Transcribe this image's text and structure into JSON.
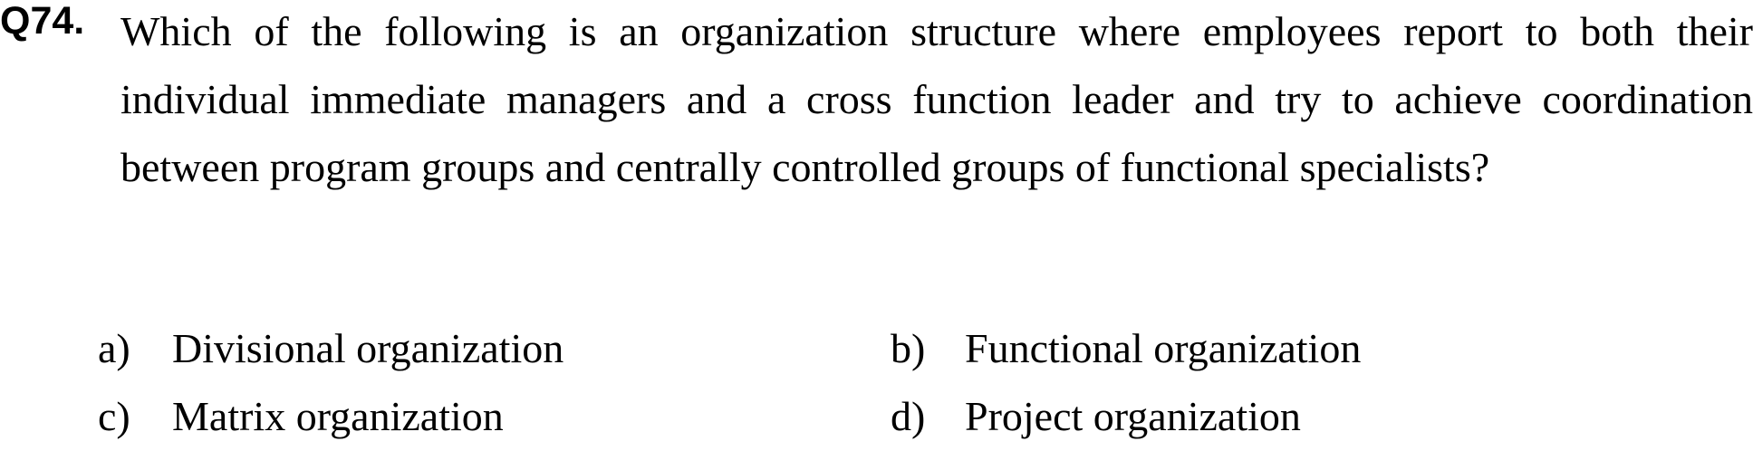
{
  "question": {
    "number": "Q74.",
    "text": "Which of the following is an organization structure where employees report to both their individual immediate managers and a cross function leader and try to achieve coordination between program groups and centrally controlled groups of functional specialists?"
  },
  "options": [
    {
      "letter": "a)",
      "text": "Divisional organization"
    },
    {
      "letter": "b)",
      "text": "Functional organization"
    },
    {
      "letter": "c)",
      "text": "Matrix organization"
    },
    {
      "letter": "d)",
      "text": "Project organization"
    }
  ]
}
